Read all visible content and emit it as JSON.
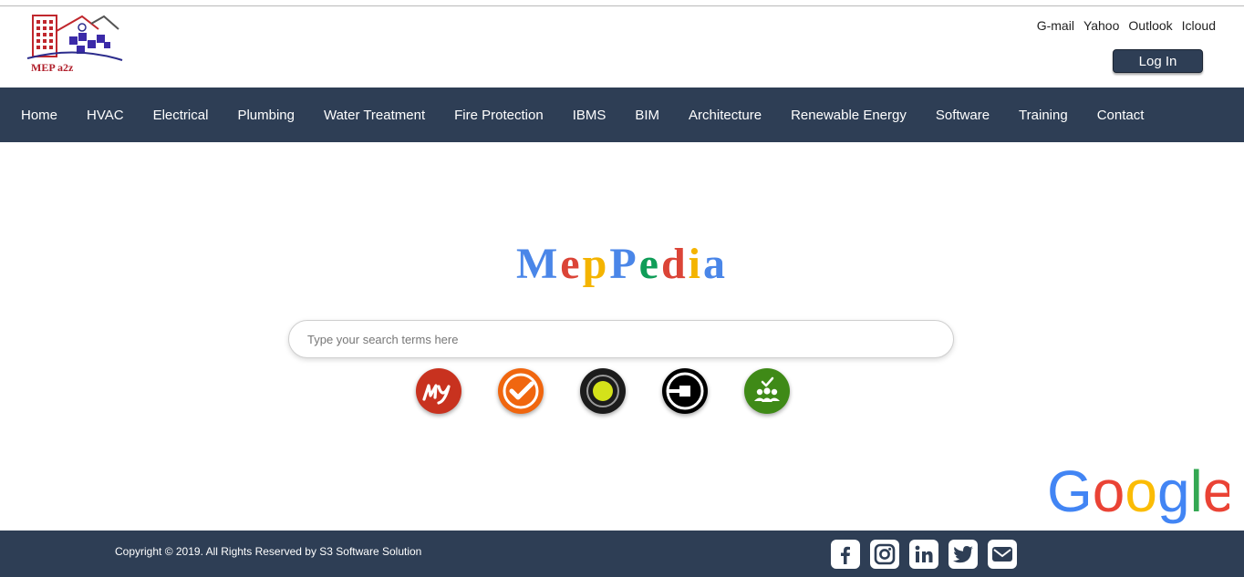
{
  "header": {
    "logo_text": "MEP a2z",
    "mail_links": [
      "G-mail",
      "Yahoo",
      "Outlook",
      "Icloud"
    ],
    "login_label": "Log In"
  },
  "nav": {
    "items": [
      "Home",
      "HVAC",
      "Electrical",
      "Plumbing",
      "Water Treatment",
      "Fire Protection",
      "IBMS",
      "BIM",
      "Architecture",
      "Renewable Energy",
      "Software",
      "Training",
      "Contact"
    ]
  },
  "main": {
    "brand_letters": [
      {
        "char": "M",
        "color": "#4a86e8"
      },
      {
        "char": "e",
        "color": "#db4437"
      },
      {
        "char": "p",
        "color": "#f4b400"
      },
      {
        "char": "P",
        "color": "#4a86e8"
      },
      {
        "char": "e",
        "color": "#0f9d58"
      },
      {
        "char": "d",
        "color": "#db4437"
      },
      {
        "char": "i",
        "color": "#f4b400"
      },
      {
        "char": "a",
        "color": "#4a86e8"
      }
    ],
    "search_placeholder": "Type your search terms here",
    "app_icons": [
      "my-app-icon",
      "checkmark-app-icon",
      "ola-app-icon",
      "uber-app-icon",
      "team-app-icon"
    ]
  },
  "google_logo": {
    "letters": [
      {
        "char": "G",
        "color": "#4285f4"
      },
      {
        "char": "o",
        "color": "#ea4335"
      },
      {
        "char": "o",
        "color": "#fbbc05"
      },
      {
        "char": "g",
        "color": "#4285f4"
      },
      {
        "char": "l",
        "color": "#34a853"
      },
      {
        "char": "e",
        "color": "#ea4335"
      }
    ]
  },
  "footer": {
    "copyright": "Copyright © 2019. All Rights Reserved by S3 Software Solution",
    "social_icons": [
      "facebook-icon",
      "instagram-icon",
      "linkedin-icon",
      "twitter-icon",
      "email-icon"
    ]
  },
  "colors": {
    "nav_bg": "#2e3e55",
    "accent_red": "#b01e2a"
  }
}
